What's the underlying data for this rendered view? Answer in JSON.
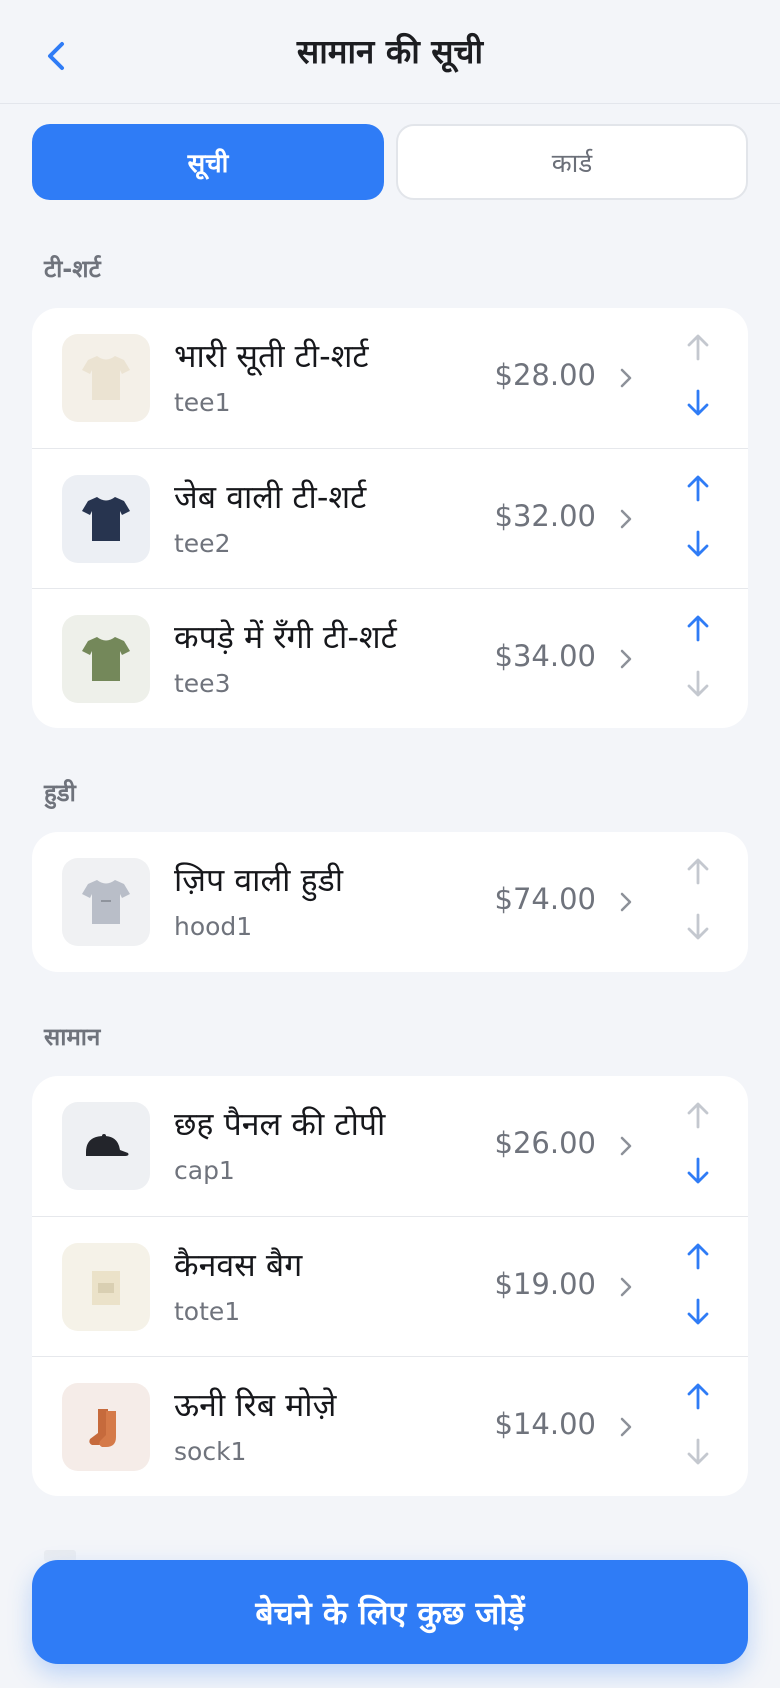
{
  "header": {
    "title": "सामान की सूची",
    "back_icon": "chevron-left-icon"
  },
  "view_toggle": {
    "list_label": "सूची",
    "card_label": "कार्ड",
    "selected": "सूची"
  },
  "colors": {
    "accent": "#2f7cf6",
    "arrow_active": "#2f7cf6",
    "arrow_disabled": "#c4c8cf"
  },
  "sections": [
    {
      "label": "टी-शर्ट",
      "items": [
        {
          "name": "भारी सूती टी-शर्ट",
          "sku": "tee1",
          "price": "$28.00",
          "up_enabled": false,
          "down_enabled": true
        },
        {
          "name": "जेब वाली टी-शर्ट",
          "sku": "tee2",
          "price": "$32.00",
          "up_enabled": true,
          "down_enabled": true
        },
        {
          "name": "कपड़े में रँगी टी-शर्ट",
          "sku": "tee3",
          "price": "$34.00",
          "up_enabled": true,
          "down_enabled": false
        }
      ]
    },
    {
      "label": "हुडी",
      "items": [
        {
          "name": "ज़िप वाली हुडी",
          "sku": "hood1",
          "price": "$74.00",
          "up_enabled": false,
          "down_enabled": false
        }
      ]
    },
    {
      "label": "सामान",
      "items": [
        {
          "name": "छह पैनल की टोपी",
          "sku": "cap1",
          "price": "$26.00",
          "up_enabled": false,
          "down_enabled": true
        },
        {
          "name": "कैनवस बैग",
          "sku": "tote1",
          "price": "$19.00",
          "up_enabled": true,
          "down_enabled": true
        },
        {
          "name": "ऊनी रिब मोज़े",
          "sku": "sock1",
          "price": "$14.00",
          "up_enabled": true,
          "down_enabled": false
        }
      ]
    }
  ],
  "cta": {
    "label": "बेचने के लिए कुछ जोड़ें"
  }
}
